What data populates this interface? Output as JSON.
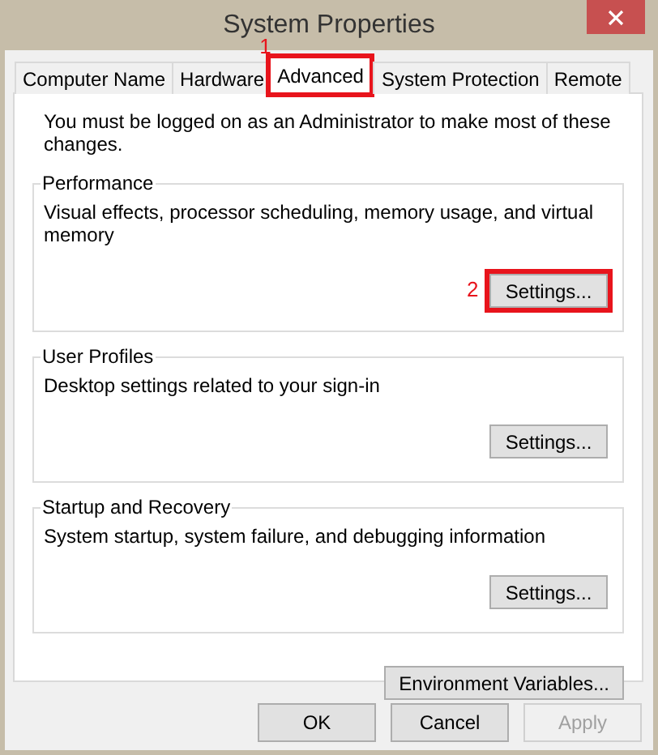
{
  "window": {
    "title": "System Properties"
  },
  "tabs": [
    {
      "label": "Computer Name",
      "selected": false
    },
    {
      "label": "Hardware",
      "selected": false
    },
    {
      "label": "Advanced",
      "selected": true,
      "annotation": "1"
    },
    {
      "label": "System Protection",
      "selected": false
    },
    {
      "label": "Remote",
      "selected": false
    }
  ],
  "notice": "You must be logged on as an Administrator to make most of these changes.",
  "groups": [
    {
      "title": "Performance",
      "description": "Visual effects, processor scheduling, memory usage, and virtual memory",
      "button": {
        "label": "Settings...",
        "annotation": "2"
      }
    },
    {
      "title": "User Profiles",
      "description": "Desktop settings related to your sign-in",
      "button": {
        "label": "Settings..."
      }
    },
    {
      "title": "Startup and Recovery",
      "description": "System startup, system failure, and debugging information",
      "button": {
        "label": "Settings..."
      }
    }
  ],
  "environment_button": "Environment Variables...",
  "buttons": [
    {
      "label": "OK",
      "disabled": false
    },
    {
      "label": "Cancel",
      "disabled": false
    },
    {
      "label": "Apply",
      "disabled": true
    }
  ]
}
